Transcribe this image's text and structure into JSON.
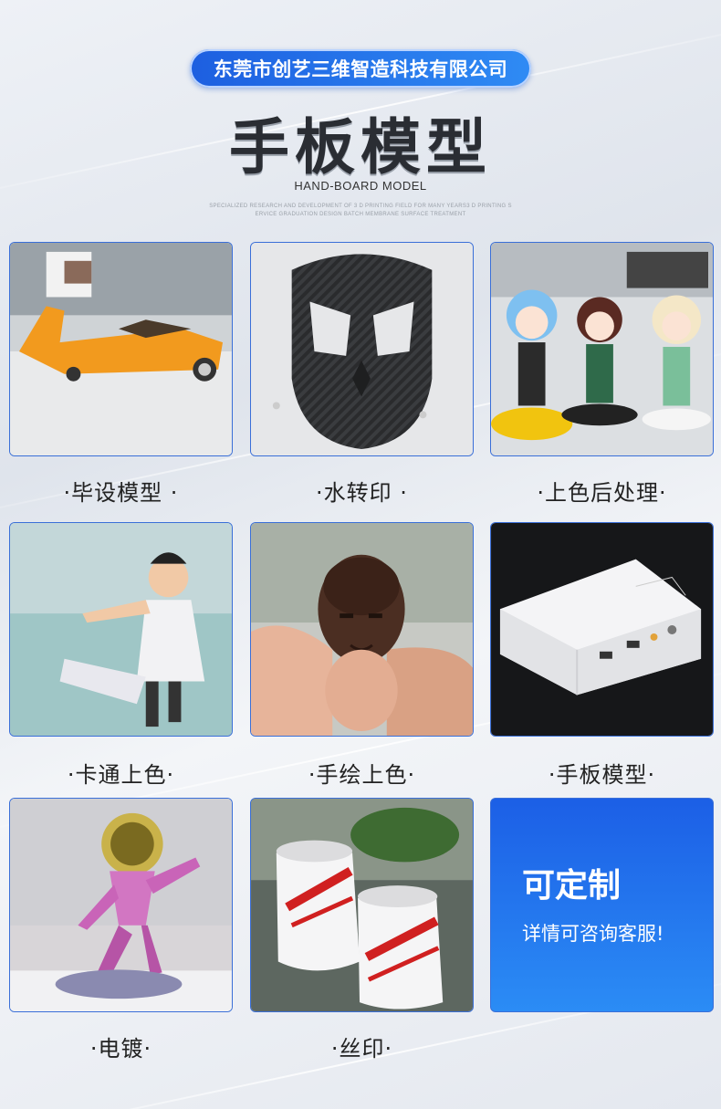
{
  "header": {
    "company": "东莞市创艺三维智造科技有限公司",
    "title": "手板模型",
    "subtitle": "HAND-BOARD MODEL",
    "description": "SPECIALIZED RESEARCH AND DEVELOPMENT OF 3 D PRINTING FIELD FOR MANY YEARS3 D PRINTING S ERVICE GRADUATION DESIGN BATCH MEMBRANE SURFACE TREATMENT"
  },
  "items": [
    {
      "caption": "·毕设模型 ·",
      "image": "orange-car-model-photo"
    },
    {
      "caption": "·水转印 ·",
      "image": "carbon-skull-mask-photo"
    },
    {
      "caption": "·上色后处理·",
      "image": "anime-figures-photo"
    },
    {
      "caption": "·卡通上色·",
      "image": "cartoon-figure-photo"
    },
    {
      "caption": "·手绘上色·",
      "image": "painted-head-photo"
    },
    {
      "caption": "·手板模型·",
      "image": "white-device-photo"
    },
    {
      "caption": "·电镀·",
      "image": "chrome-astronaut-photo"
    },
    {
      "caption": "·丝印·",
      "image": "printed-cans-photo"
    }
  ],
  "custom": {
    "title": "可定制",
    "subtitle": "详情可咨询客服!"
  },
  "colors": {
    "accent": "#2f7bf0",
    "title": "#2a2d33"
  }
}
